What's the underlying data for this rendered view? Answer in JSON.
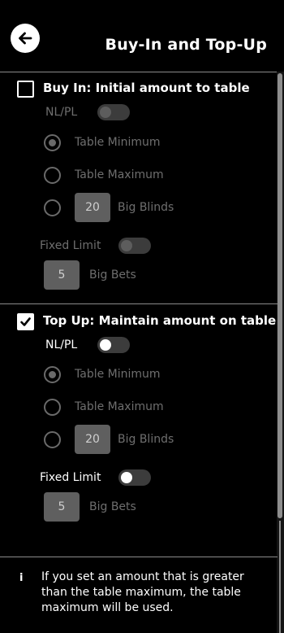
{
  "header": {
    "title": "Buy-In and Top-Up",
    "back_icon": "arrow-left-icon"
  },
  "buy_in": {
    "checked": false,
    "title": "Buy In: Initial amount to table",
    "nlpl_label": "NL/PL",
    "nlpl_on": false,
    "options": {
      "table_min": "Table Minimum",
      "table_max": "Table Maximum",
      "big_blinds_value": "20",
      "big_blinds_label": "Big Blinds"
    },
    "selected_option": "Table Minimum",
    "fixed_limit_label": "Fixed Limit",
    "fixed_limit_on": false,
    "big_bets_value": "5",
    "big_bets_label": "Big Bets"
  },
  "top_up": {
    "checked": true,
    "title": "Top Up: Maintain amount on table",
    "nlpl_label": "NL/PL",
    "nlpl_on": false,
    "options": {
      "table_min": "Table Minimum",
      "table_max": "Table Maximum",
      "big_blinds_value": "20",
      "big_blinds_label": "Big Blinds"
    },
    "selected_option": "Table Minimum",
    "fixed_limit_label": "Fixed Limit",
    "fixed_limit_on": false,
    "big_bets_value": "5",
    "big_bets_label": "Big Bets"
  },
  "info": {
    "icon": "i",
    "text": "If you set an amount that is greater than the table maximum, the table maximum will be used."
  }
}
